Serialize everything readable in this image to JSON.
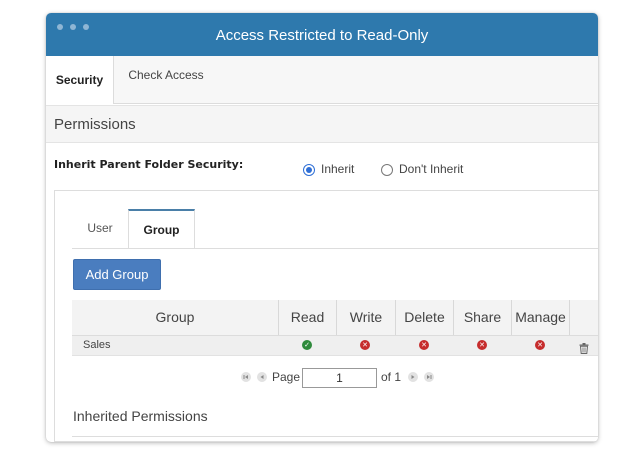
{
  "window": {
    "title": "Access Restricted to Read-Only"
  },
  "tabs": [
    {
      "label": "Security",
      "active": true
    },
    {
      "label": "Check Access",
      "active": false
    }
  ],
  "permissions": {
    "header": "Permissions",
    "inherit_label": "Inherit Parent Folder Security:",
    "options": [
      {
        "label": "Inherit",
        "checked": true
      },
      {
        "label": "Don't Inherit",
        "checked": false
      }
    ]
  },
  "subtabs": [
    {
      "label": "User",
      "active": false
    },
    {
      "label": "Group",
      "active": true
    }
  ],
  "add_button": "Add Group",
  "grid": {
    "columns": [
      "Group",
      "Read",
      "Write",
      "Delete",
      "Share",
      "Manage"
    ],
    "rows": [
      {
        "name": "Sales",
        "read": "allowed",
        "write": "denied",
        "delete": "denied",
        "share": "denied",
        "manage": "denied"
      }
    ]
  },
  "pager": {
    "label": "Page",
    "value": "1",
    "of_label": "of 1"
  },
  "inherited": {
    "label": "Inherited Permissions"
  },
  "colors": {
    "titlebar": "#2e79ad",
    "button": "#4a7dbf",
    "allowed": "#2f8a3c",
    "denied": "#c62d2d"
  },
  "icons": [
    "window-dot-icon",
    "radio-icon",
    "check-circle-icon",
    "x-circle-icon",
    "trash-icon",
    "first-page-icon",
    "prev-page-icon",
    "next-page-icon",
    "last-page-icon"
  ]
}
